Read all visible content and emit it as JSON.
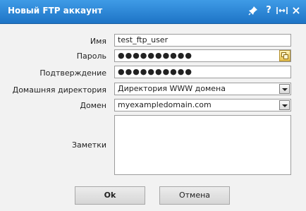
{
  "dialog": {
    "title": "Новый FTP аккаунт",
    "title_bar_color": "#2d87d6",
    "icons": [
      "pin-icon",
      "help-icon",
      "resize-icon",
      "close-icon"
    ],
    "help_glyph": "?",
    "close_glyph": "×"
  },
  "form": {
    "name_label": "Имя",
    "name_value": "test_ftp_user",
    "password_label": "Пароль",
    "password_value": "●●●●●●●●●●",
    "confirm_label": "Подтверждение",
    "confirm_value": "●●●●●●●●●●",
    "home_dir_label": "Домашняя директория",
    "home_dir_value": "Директория WWW домена",
    "domain_label": "Домен",
    "domain_value": "myexampledomain.com",
    "notes_label": "Заметки",
    "notes_value": ""
  },
  "buttons": {
    "ok": "Ok",
    "cancel": "Отмена"
  }
}
